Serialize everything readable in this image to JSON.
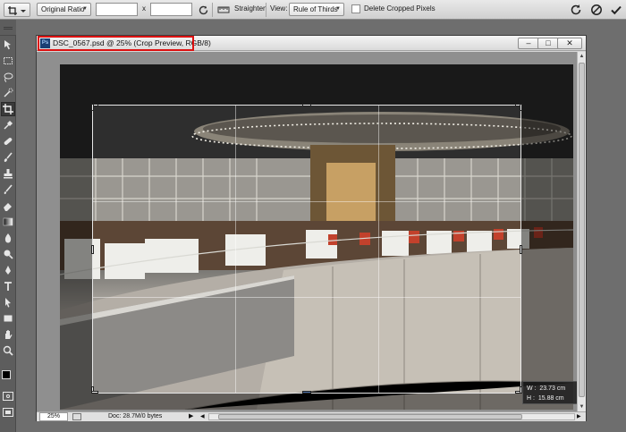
{
  "options_bar": {
    "ratio_select": "Original Ratio",
    "ratio_x": "x",
    "straighten_label": "Straighten",
    "view_label": "View:",
    "view_select": "Rule of Thirds",
    "delete_cropped_label": "Delete Cropped Pixels"
  },
  "document": {
    "title": "DSC_0567.psd @ 25% (Crop Preview, RGB/8)",
    "ps_badge": "Ps",
    "minimize_glyph": "–",
    "maximize_glyph": "□",
    "close_glyph": "✕"
  },
  "crop_info": {
    "w_label": "W :",
    "w_value": "23.73 cm",
    "h_label": "H :",
    "h_value": "15.88 cm"
  },
  "status_bar": {
    "zoom": "25%",
    "doc_info": "Doc: 28.7M/0 bytes"
  },
  "colors": {
    "highlight": "#dd1111",
    "workspace": "#6e6e6e",
    "toolbar": "#5d5d5d"
  },
  "icons": [
    "crop-tool-preset-icon",
    "rotate-icon",
    "straighten-icon",
    "reset-icon",
    "cancel-icon",
    "commit-checkmark-icon",
    "move-tool-icon",
    "marquee-tool-icon",
    "lasso-tool-icon",
    "quick-select-tool-icon",
    "crop-tool-icon",
    "eyedropper-tool-icon",
    "healing-brush-icon",
    "brush-tool-icon",
    "clone-stamp-icon",
    "history-brush-icon",
    "eraser-tool-icon",
    "gradient-tool-icon",
    "blur-tool-icon",
    "dodge-tool-icon",
    "pen-tool-icon",
    "type-tool-icon",
    "path-select-icon",
    "shape-tool-icon",
    "hand-tool-icon",
    "zoom-tool-icon"
  ]
}
